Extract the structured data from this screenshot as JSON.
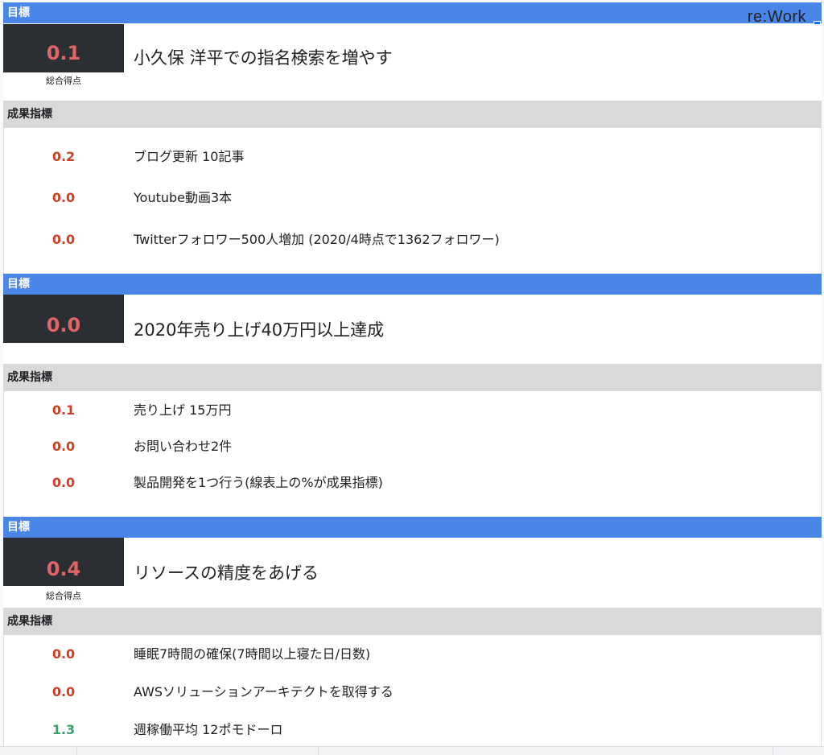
{
  "brand": "re:Work",
  "sections": [
    {
      "header": "目標",
      "score": "0.1",
      "caption": "総合得点",
      "title": "小久保 洋平での指名検索を増やす",
      "kpi_header": "成果指標",
      "kpis": [
        {
          "score": "0.2",
          "text": "ブログ更新 10記事"
        },
        {
          "score": "0.0",
          "text": "Youtube動画3本"
        },
        {
          "score": "0.0",
          "text": "Twitterフォロワー500人増加 (2020/4時点で1362フォロワー)"
        }
      ]
    },
    {
      "header": "目標",
      "score": "0.0",
      "caption": "",
      "title": "2020年売り上げ40万円以上達成",
      "kpi_header": "成果指標",
      "kpis": [
        {
          "score": "0.1",
          "text": "売り上げ 15万円"
        },
        {
          "score": "0.0",
          "text": "お問い合わせ2件"
        },
        {
          "score": "0.0",
          "text": "製品開発を1つ行う(線表上の%が成果指標)"
        }
      ]
    },
    {
      "header": "目標",
      "score": "0.4",
      "caption": "総合得点",
      "title": "リソースの精度をあげる",
      "kpi_header": "成果指標",
      "kpis": [
        {
          "score": "0.0",
          "text": "睡眠7時間の確保(7時間以上寝た日/日数)"
        },
        {
          "score": "0.0",
          "text": "AWSソリューションアーキテクトを取得する"
        },
        {
          "score": "1.3",
          "text": "週稼働平均 12ポモドーロ"
        }
      ]
    }
  ],
  "colors": {
    "header_blue": "#4a86e8",
    "score_dark": "#2b2f33",
    "score_red": "#cc4125",
    "score_green": "#38a169",
    "kpi_header_gray": "#d9d9d9"
  }
}
